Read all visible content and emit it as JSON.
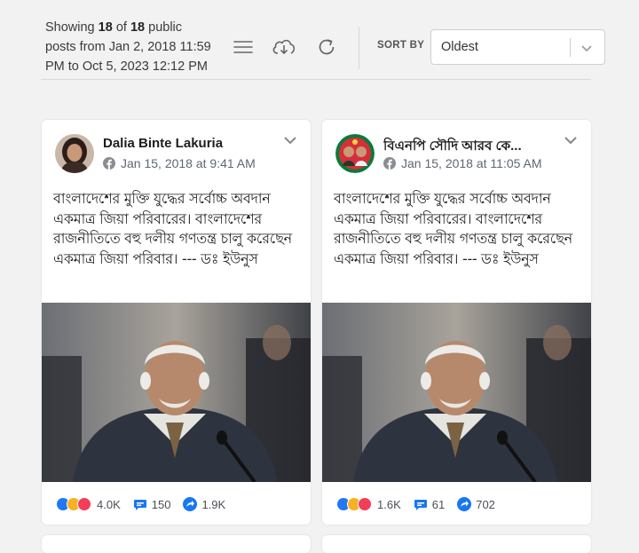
{
  "summary": {
    "showing": "Showing",
    "count": "18",
    "of": "of",
    "total": "18",
    "suffix": "public",
    "line2": "posts from Jan 2, 2018 11:59",
    "line3": "PM to Oct 5, 2023 12:12 PM"
  },
  "toolbar": {
    "icons": [
      "list-icon",
      "cloud-download-icon",
      "refresh-icon"
    ],
    "sort_label": "SORT BY",
    "sort_value": "Oldest"
  },
  "posts": [
    {
      "author": "Dalia Binte Lakuria",
      "date": "Jan 15, 2018 at 9:41 AM",
      "text": "বাংলাদেশের মুক্তি যুদ্ধের সর্বোচ্চ অবদান একমাত্র জিয়া পরিবারের। বাংলাদেশের রাজনীতিতে বহু দলীয় গণতন্ত্র চালু করেছেন একমাত্র জিয়া পরিবার। --- ডঃ ইউনুস",
      "reactions": "4.0K",
      "comments": "150",
      "shares": "1.9K"
    },
    {
      "author": "বিএনপি সৌদি আরব কে...",
      "date": "Jan 15, 2018 at 11:05 AM",
      "text": "বাংলাদেশের মুক্তি যুদ্ধের সর্বোচ্চ অবদান একমাত্র জিয়া পরিবারের। বাংলাদেশের রাজনীতিতে বহু দলীয় গণতন্ত্র চালু করেছেন একমাত্র জিয়া পরিবার। --- ডঃ ইউনুস",
      "reactions": "1.6K",
      "comments": "61",
      "shares": "702"
    }
  ],
  "colors": {
    "facebook_blue": "#1877f2",
    "like": "#2078f4",
    "haha": "#f7b125",
    "love": "#f33e58",
    "background": "#f2f2f2"
  }
}
